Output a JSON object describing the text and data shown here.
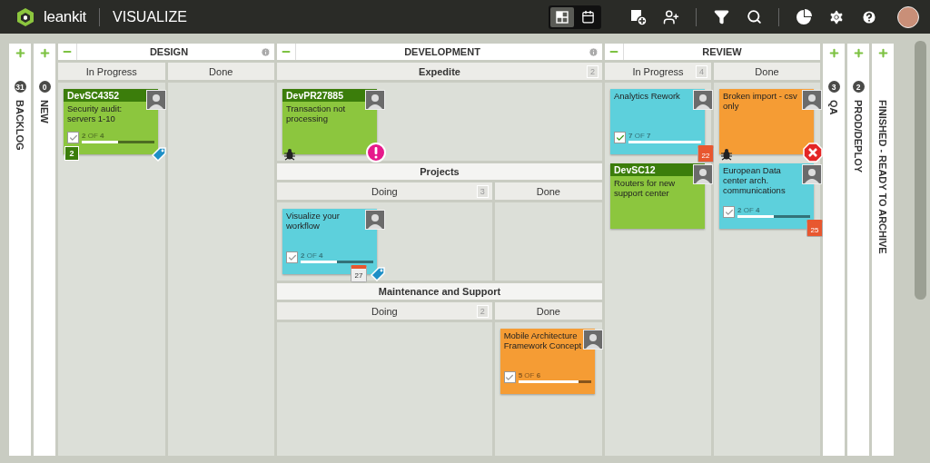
{
  "topbar": {
    "brand": "leankit",
    "title": "VISUALIZE",
    "views": [
      {
        "kind": "board",
        "selected": true
      },
      {
        "kind": "calendar",
        "selected": false
      }
    ]
  },
  "lanes": [
    {
      "kind": "collapsed",
      "title": "BACKLOG",
      "count": "31"
    },
    {
      "kind": "collapsed",
      "title": "NEW",
      "count": "0"
    },
    {
      "kind": "expanded",
      "title": "DESIGN",
      "info": true,
      "rows": [
        {
          "columns": [
            {
              "title": "In Progress",
              "cards": [
                {
                  "id": "DevSC4352",
                  "title": "Security audit: servers 1-10",
                  "color": "#8cc63e",
                  "progress": {
                    "text": "**2** OF **4**",
                    "level": 0.5,
                    "complete": false
                  },
                  "badges": [
                    {
                      "kind": "size",
                      "text": "2"
                    },
                    {
                      "kind": "tag"
                    }
                  ]
                }
              ]
            },
            {
              "title": "Done"
            }
          ]
        }
      ]
    },
    {
      "kind": "expanded",
      "title": "DEVELOPMENT",
      "info": true,
      "rows": [
        {
          "columns": [
            {
              "title": "Expedite",
              "count": "2",
              "cards": [
                {
                  "id": "DevPR27885",
                  "title": "Transaction not processing",
                  "color": "#8cc63e",
                  "badges": [
                    {
                      "kind": "bug"
                    },
                    {
                      "kind": "priority"
                    }
                  ]
                }
              ]
            }
          ]
        },
        {
          "title": "Projects",
          "columns": [
            {
              "title": "Doing",
              "count": "3",
              "cards": [
                {
                  "title": "Visualize your workflow",
                  "color": "#5dd0dc",
                  "progress": {
                    "text": "**2** OF **4**",
                    "level": 0.5,
                    "complete": false
                  },
                  "badges": [
                    {
                      "kind": "date",
                      "text": "27"
                    },
                    {
                      "kind": "tag"
                    }
                  ]
                }
              ]
            },
            {
              "title": "Done"
            }
          ]
        },
        {
          "title": "Maintenance and Support",
          "columns": [
            {
              "title": "Doing",
              "count": "2"
            },
            {
              "title": "Done",
              "cards": [
                {
                  "title": "Mobile Architecture Framework Concept",
                  "color": "#f59c34",
                  "progress": {
                    "text": "**5** OF **6**",
                    "level": 0.83,
                    "complete": false
                  }
                }
              ]
            }
          ]
        }
      ]
    },
    {
      "kind": "expanded",
      "title": "REVIEW",
      "info": false,
      "rows": [
        {
          "columns": [
            {
              "title": "In Progress",
              "count": "4",
              "cards": [
                {
                  "title": "Analytics Rework",
                  "color": "#5dd0dc",
                  "progress": {
                    "text": "**7** OF **7**",
                    "level": 1,
                    "complete": true
                  },
                  "badges": [
                    {
                      "kind": "date",
                      "text": "22"
                    }
                  ]
                },
                {
                  "id": "DevSC12",
                  "title": "Routers for new support center",
                  "color": "#8cc63e"
                }
              ]
            },
            {
              "title": "Done",
              "cards": [
                {
                  "title": "Broken import - csv only",
                  "color": "#f59c34",
                  "badges": [
                    {
                      "kind": "bug"
                    },
                    {
                      "kind": "blocked"
                    }
                  ]
                },
                {
                  "title": "European Data center arch. communications",
                  "color": "#5dd0dc",
                  "progress": {
                    "text": "**2** OF **4**",
                    "level": 0.5,
                    "complete": false
                  },
                  "badges": [
                    {
                      "kind": "date",
                      "text": "25"
                    }
                  ]
                }
              ]
            }
          ]
        }
      ]
    },
    {
      "kind": "collapsed",
      "title": "QA",
      "count": "3"
    },
    {
      "kind": "collapsed",
      "title": "PROD/DEPLOY",
      "count": "2"
    },
    {
      "kind": "collapsed",
      "title": "FINISHED - READY TO ARCHIVE"
    }
  ]
}
